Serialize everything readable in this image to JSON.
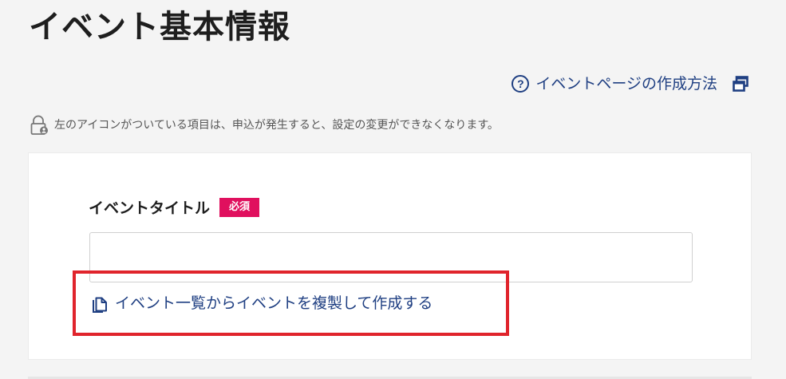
{
  "page": {
    "title": "イベント基本情報"
  },
  "help": {
    "link_label": "イベントページの作成方法"
  },
  "notice": {
    "lock_text": "左のアイコンがついている項目は、申込が発生すると、設定の変更ができなくなります。"
  },
  "form": {
    "event_title_label": "イベントタイトル",
    "required_badge": "必須",
    "event_title_value": "",
    "copy_link_label": "イベント一覧からイベントを複製して作成する"
  },
  "colors": {
    "link": "#1f3f82",
    "required": "#e0105e",
    "highlight": "#e0242c"
  }
}
